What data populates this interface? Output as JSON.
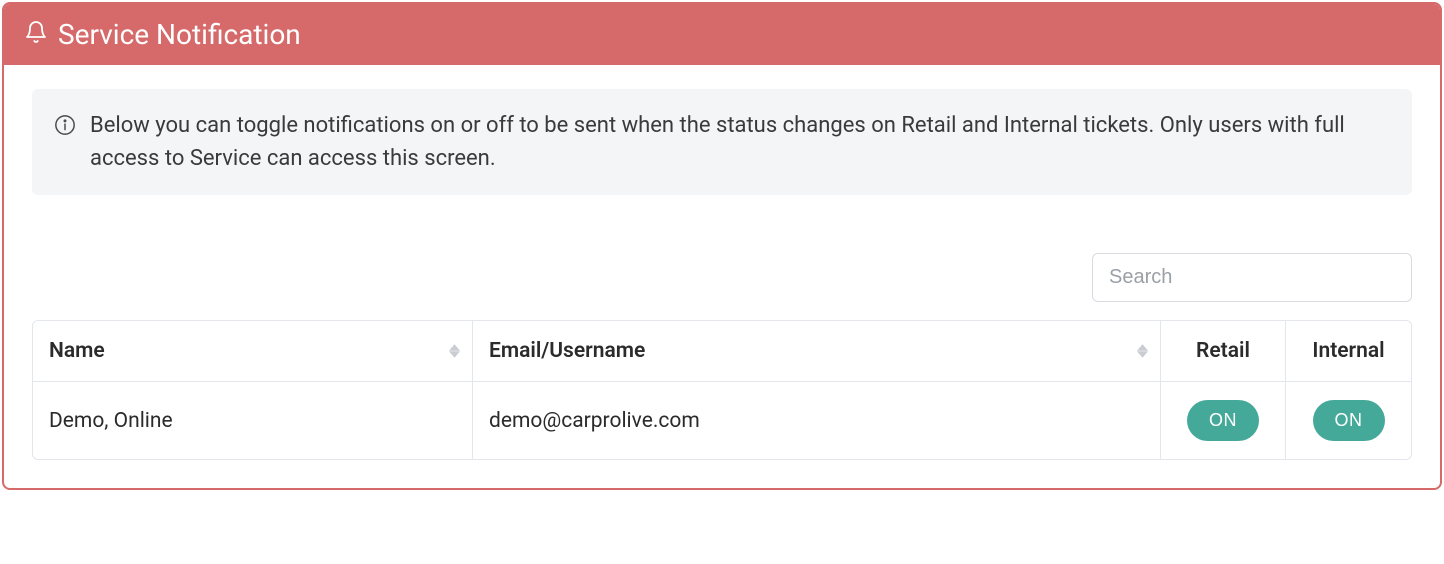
{
  "header": {
    "title": "Service Notification"
  },
  "info": {
    "text": "Below you can toggle notifications on or off to be sent when the status changes on Retail and Internal tickets. Only users with full access to Service can access this screen."
  },
  "search": {
    "placeholder": "Search"
  },
  "table": {
    "columns": {
      "name": "Name",
      "email": "Email/Username",
      "retail": "Retail",
      "internal": "Internal"
    },
    "rows": [
      {
        "name": "Demo, Online",
        "email": "demo@carprolive.com",
        "retail": "ON",
        "internal": "ON"
      }
    ]
  }
}
